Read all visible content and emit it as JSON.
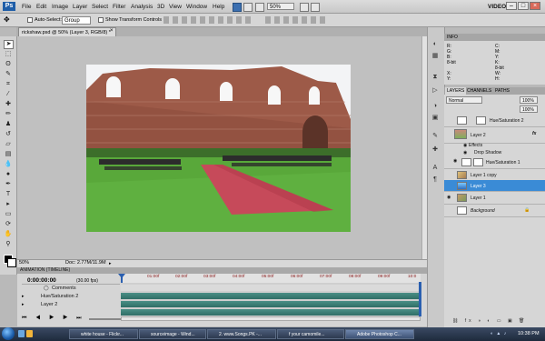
{
  "menubar": {
    "logo": "Ps",
    "items": [
      "File",
      "Edit",
      "Image",
      "Layer",
      "Select",
      "Filter",
      "Analysis",
      "3D",
      "View",
      "Window",
      "Help"
    ],
    "zoom": "50%",
    "workspace": "VIDEO ▾"
  },
  "options": {
    "auto_select": "Auto-Select:",
    "group": "Group",
    "show_transform": "Show Transform Controls"
  },
  "document": {
    "tab_title": "rickshaw.psd @ 50% (Layer 3, RGB/8) *",
    "zoom": "50%",
    "doc_size": "Doc: 2.77M/11.9M"
  },
  "animation": {
    "header": "ANIMATION (TIMELINE)",
    "time": "0:00:00:00",
    "fps": "(30.00 fps)",
    "ticks": [
      "01:00f",
      "02:00f",
      "03:00f",
      "04:00f",
      "05:00f",
      "06:00f",
      "07:00f",
      "08:00f",
      "09:00f",
      "10:0"
    ],
    "rows": [
      "Comments",
      "Hue/Saturation 2",
      "Layer 2"
    ]
  },
  "info": {
    "title": "INFO",
    "r": "R:",
    "g": "G:",
    "b": "B:",
    "c": "C:",
    "m": "M:",
    "y": "Y:",
    "k": "K:",
    "bits": "8-bit",
    "x": "X:",
    "yy": "Y:",
    "w": "W:",
    "h": "H:"
  },
  "layers": {
    "tabs": [
      "LAYERS",
      "CHANNELS",
      "PATHS"
    ],
    "blend": "Normal",
    "opacity": "100%",
    "fill": "100%",
    "items": [
      {
        "name": "Hue/Saturation 2"
      },
      {
        "name": "Layer 2"
      },
      {
        "name": "Effects"
      },
      {
        "name": "Drop Shadow"
      },
      {
        "name": "Hue/Saturation 1"
      },
      {
        "name": "Layer 1 copy"
      },
      {
        "name": "Layer 3"
      },
      {
        "name": "Layer 1"
      },
      {
        "name": "Background"
      }
    ],
    "fx": "fx"
  },
  "taskbar": {
    "buttons": [
      "white house - Flickr...",
      "sourceimage - Wind...",
      "2. www.Songs.PK -...",
      "f your camomile...",
      "Adobe Photoshop C..."
    ],
    "clock": "10:38 PM"
  },
  "colors": {
    "selection": "#3a8bd6",
    "carpet": "#c64a5a",
    "lawn": "#59a83a",
    "wall": "#9d5a48"
  }
}
